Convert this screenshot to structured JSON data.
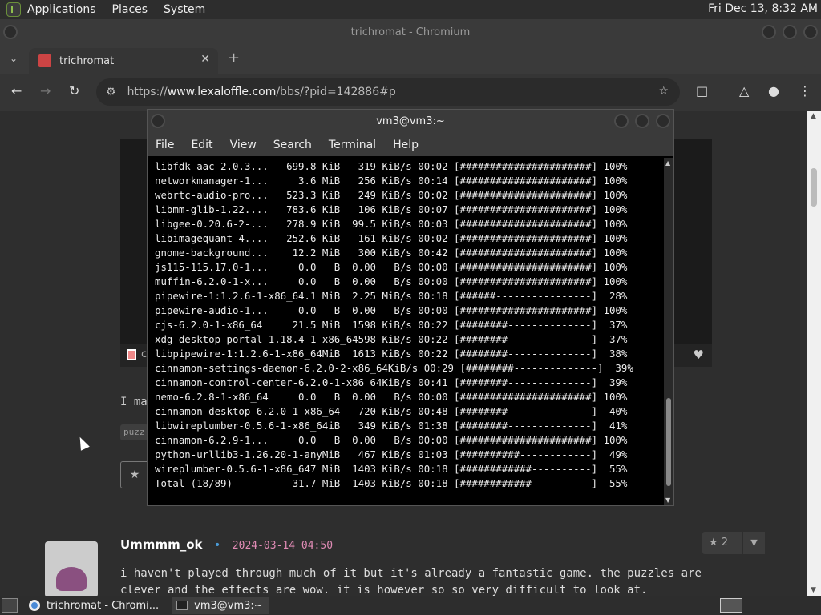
{
  "top_panel": {
    "menu": [
      "Applications",
      "Places",
      "System"
    ],
    "clock": "Fri Dec 13,  8:32 AM"
  },
  "chromium": {
    "window_title": "trichromat - Chromium",
    "tab": {
      "title": "trichromat",
      "close": "✕"
    },
    "new_tab": "+",
    "url_prefix": "https://",
    "url_host": "www.lexaloffle.com",
    "url_path": "/bbs/?pid=142886#p"
  },
  "page": {
    "embed_label": "c",
    "post_text": "I ma",
    "tag": "puzz",
    "comment": {
      "user": "Ummmm_ok",
      "dot": "•",
      "date": "2024-03-14 04:50",
      "votes": "2",
      "body": "i haven't played through much of it but it's already a fantastic game. the puzzles are clever and the effects are wow. it is however so so very difficult to look at."
    }
  },
  "terminal": {
    "title": "vm3@vm3:~",
    "menu": [
      "File",
      "Edit",
      "View",
      "Search",
      "Terminal",
      "Help"
    ],
    "lines": [
      "libfdk-aac-2.0.3...   699.8 KiB   319 KiB/s 00:02 [######################] 100%",
      "networkmanager-1...     3.6 MiB   256 KiB/s 00:14 [######################] 100%",
      "webrtc-audio-pro...   523.3 KiB   249 KiB/s 00:02 [######################] 100%",
      "libmm-glib-1.22....   783.6 KiB   106 KiB/s 00:07 [######################] 100%",
      "libgee-0.20.6-2-...   278.9 KiB  99.5 KiB/s 00:03 [######################] 100%",
      "libimagequant-4....   252.6 KiB   161 KiB/s 00:02 [######################] 100%",
      "gnome-background...    12.2 MiB   300 KiB/s 00:42 [######################] 100%",
      "js115-115.17.0-1...     0.0   B  0.00   B/s 00:00 [######################] 100%",
      "muffin-6.2.0-1-x...     0.0   B  0.00   B/s 00:00 [######################] 100%",
      "pipewire-1:1.2.6-1-x86_64.1 MiB  2.25 MiB/s 00:18 [######----------------]  28%",
      "pipewire-audio-1...     0.0   B  0.00   B/s 00:00 [######################] 100%",
      "cjs-6.2.0-1-x86_64     21.5 MiB  1598 KiB/s 00:22 [########--------------]  37%",
      "xdg-desktop-portal-1.18.4-1-x86_64598 KiB/s 00:22 [########--------------]  37%",
      "libpipewire-1:1.2.6-1-x86_64MiB  1613 KiB/s 00:22 [########--------------]  38%",
      "cinnamon-settings-daemon-6.2.0-2-x86_64KiB/s 00:29 [########--------------]  39%",
      "cinnamon-control-center-6.2.0-1-x86_64KiB/s 00:41 [########--------------]  39%",
      "nemo-6.2.8-1-x86_64     0.0   B  0.00   B/s 00:00 [######################] 100%",
      "cinnamon-desktop-6.2.0-1-x86_64   720 KiB/s 00:48 [########--------------]  40%",
      "libwireplumber-0.5.6-1-x86_64iB   349 KiB/s 01:38 [########--------------]  41%",
      "cinnamon-6.2.9-1...     0.0   B  0.00   B/s 00:00 [######################] 100%",
      "python-urllib3-1.26.20-1-anyMiB   467 KiB/s 01:03 [##########------------]  49%",
      "wireplumber-0.5.6-1-x86_647 MiB  1403 KiB/s 00:18 [############----------]  55%",
      "Total (18/89)          31.7 MiB  1403 KiB/s 00:18 [############----------]  55%"
    ]
  },
  "taskbar": {
    "tasks": [
      "trichromat - Chromi...",
      "vm3@vm3:~"
    ]
  }
}
